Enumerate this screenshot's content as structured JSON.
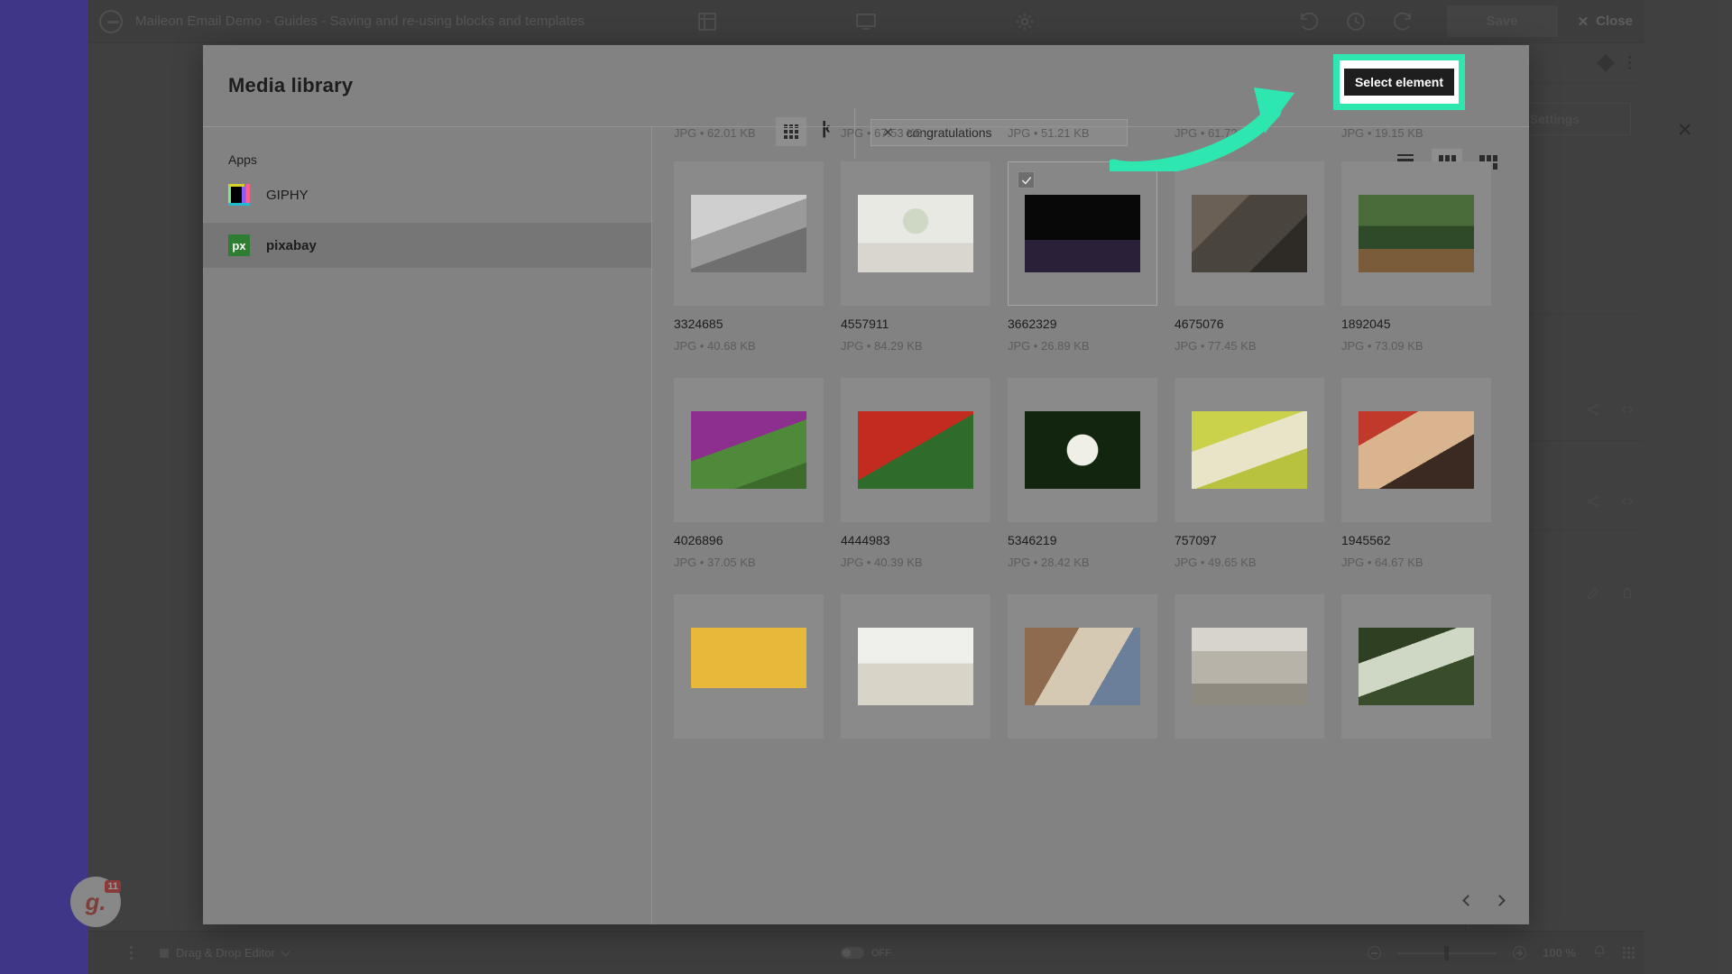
{
  "editor": {
    "title": "Maileon Email Demo - Guides - Saving and re-using blocks and templates",
    "save_label": "Save",
    "close_label": "Close",
    "settings_label": "Settings",
    "bottom_menu_label": "Drag & Drop Editor",
    "preview_toggle_label": "OFF",
    "zoom_level": "100 %",
    "giphy_badge_letter": "g.",
    "giphy_badge_count": "11"
  },
  "modal": {
    "title": "Media library",
    "close_icon": "close-icon",
    "apps_label": "Apps",
    "apps": [
      {
        "label": "GIPHY",
        "icon": "giphy-icon",
        "selected": false
      },
      {
        "label": "pixabay",
        "icon": "pixabay-icon",
        "selected": true
      }
    ],
    "search": {
      "value": "congratulations",
      "clear_icon": "clear-icon"
    },
    "view_modes": [
      {
        "name": "list-view",
        "active": false
      },
      {
        "name": "grid-view",
        "active": true
      },
      {
        "name": "masonry-view",
        "active": false
      }
    ],
    "pagination": {
      "prev_icon": "chevron-left-icon",
      "next_icon": "chevron-right-icon"
    }
  },
  "annotation": {
    "tooltip_label": "Select element",
    "highlight_color": "#2ee6b0",
    "arrow_color": "#2ee6b0"
  },
  "tiles": {
    "row0_meta": [
      "JPG  • 62.01 KB",
      "JPG  • 67.53 KB",
      "JPG  • 51.21 KB",
      "JPG  • 61.72 KB",
      "JPG  • 19.15 KB"
    ],
    "row1": [
      {
        "name": "3324685",
        "meta": "JPG  • 40.68 KB",
        "selected": false,
        "thumb": "t1"
      },
      {
        "name": "4557911",
        "meta": "JPG  • 84.29 KB",
        "selected": false,
        "thumb": "t2"
      },
      {
        "name": "3662329",
        "meta": "JPG  • 26.89 KB",
        "selected": true,
        "thumb": "t3"
      },
      {
        "name": "4675076",
        "meta": "JPG  • 77.45 KB",
        "selected": false,
        "thumb": "t4"
      },
      {
        "name": "1892045",
        "meta": "JPG  • 73.09 KB",
        "selected": false,
        "thumb": "t5"
      }
    ],
    "row2": [
      {
        "name": "4026896",
        "meta": "JPG  • 37.05 KB",
        "selected": false,
        "thumb": "t6"
      },
      {
        "name": "4444983",
        "meta": "JPG  • 40.39 KB",
        "selected": false,
        "thumb": "t7"
      },
      {
        "name": "5346219",
        "meta": "JPG  • 28.42 KB",
        "selected": false,
        "thumb": "t8"
      },
      {
        "name": "757097",
        "meta": "JPG  • 49.65 KB",
        "selected": false,
        "thumb": "t9"
      },
      {
        "name": "1945562",
        "meta": "JPG  • 64.67 KB",
        "selected": false,
        "thumb": "t10"
      }
    ],
    "row3": [
      {
        "name": "",
        "meta": "",
        "selected": false,
        "thumb": "t11"
      },
      {
        "name": "",
        "meta": "",
        "selected": false,
        "thumb": "t12"
      },
      {
        "name": "",
        "meta": "",
        "selected": false,
        "thumb": "t13"
      },
      {
        "name": "",
        "meta": "",
        "selected": false,
        "thumb": "t14"
      },
      {
        "name": "",
        "meta": "",
        "selected": false,
        "thumb": "t15"
      }
    ]
  }
}
